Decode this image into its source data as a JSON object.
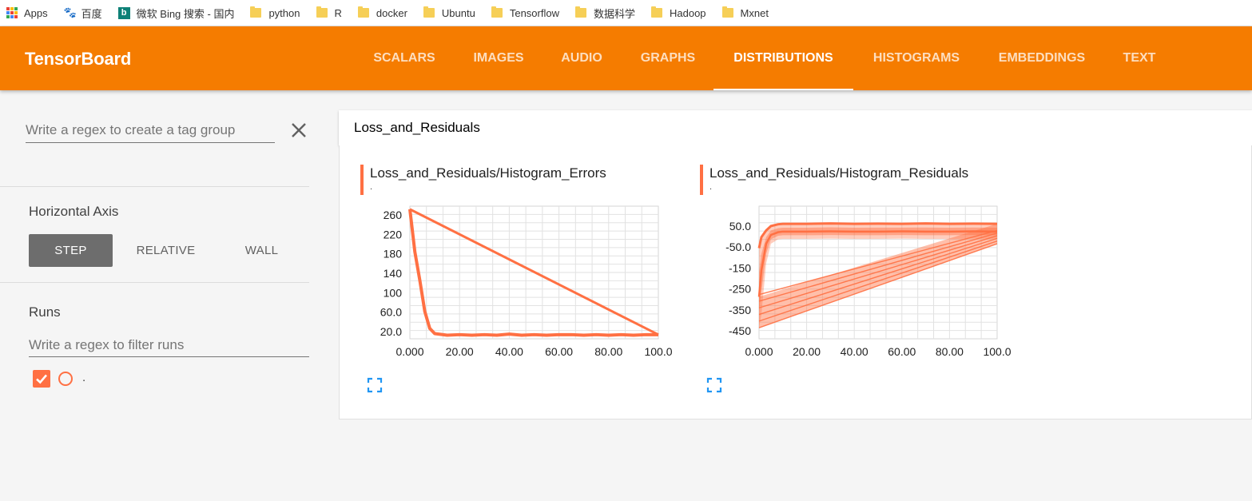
{
  "bookmarks": [
    {
      "label": "Apps",
      "icon": "apps-grid-icon"
    },
    {
      "label": "百度",
      "icon": "baidu-icon"
    },
    {
      "label": "微软 Bing 搜索 - 国内",
      "icon": "bing-icon"
    },
    {
      "label": "python",
      "icon": "folder-icon"
    },
    {
      "label": "R",
      "icon": "folder-icon"
    },
    {
      "label": "docker",
      "icon": "folder-icon"
    },
    {
      "label": "Ubuntu",
      "icon": "folder-icon"
    },
    {
      "label": "Tensorflow",
      "icon": "folder-icon"
    },
    {
      "label": "数据科学",
      "icon": "folder-icon"
    },
    {
      "label": "Hadoop",
      "icon": "folder-icon"
    },
    {
      "label": "Mxnet",
      "icon": "folder-icon"
    }
  ],
  "header": {
    "brand": "TensorBoard",
    "tabs": [
      "SCALARS",
      "IMAGES",
      "AUDIO",
      "GRAPHS",
      "DISTRIBUTIONS",
      "HISTOGRAMS",
      "EMBEDDINGS",
      "TEXT"
    ],
    "active_tab": "DISTRIBUTIONS",
    "color": "#f57c00"
  },
  "sidebar": {
    "tag_regex_placeholder": "Write a regex to create a tag group",
    "horizontal_axis_title": "Horizontal Axis",
    "axis_options": [
      "STEP",
      "RELATIVE",
      "WALL"
    ],
    "axis_selected": "STEP",
    "runs_title": "Runs",
    "runs_regex_placeholder": "Write a regex to filter runs",
    "runs": [
      {
        "label": ".",
        "checked": true,
        "color": "#ff7043"
      }
    ]
  },
  "main": {
    "group_title": "Loss_and_Residuals",
    "series_color": "#ff7043"
  },
  "chart_data": [
    {
      "type": "area",
      "title": "Loss_and_Residuals/Histogram_Errors",
      "subtitle": ".",
      "x_ticks": [
        "0.000",
        "20.00",
        "40.00",
        "60.00",
        "80.00",
        "100.0"
      ],
      "y_ticks": [
        "260",
        "220",
        "180",
        "140",
        "100",
        "60.0",
        "20.0"
      ],
      "xlim": [
        0,
        100
      ],
      "ylim": [
        12,
        268
      ],
      "grid": true,
      "x": [
        0,
        2,
        4,
        6,
        8,
        10,
        15,
        20,
        25,
        30,
        35,
        40,
        45,
        50,
        55,
        60,
        65,
        70,
        75,
        80,
        85,
        90,
        95,
        100
      ],
      "values": [
        262,
        180,
        125,
        65,
        32,
        22,
        19,
        20,
        19,
        20,
        19,
        21,
        19,
        20,
        19,
        20,
        20,
        19,
        20,
        19,
        20,
        19,
        20,
        20
      ],
      "wraparound_line": [
        [
          0,
          262
        ],
        [
          100,
          20
        ]
      ]
    },
    {
      "type": "area",
      "title": "Loss_and_Residuals/Histogram_Residuals",
      "subtitle": ".",
      "x_ticks": [
        "0.000",
        "20.00",
        "40.00",
        "60.00",
        "80.00",
        "100.0"
      ],
      "y_ticks": [
        "50.0",
        "-50.0",
        "-150",
        "-250",
        "-350",
        "-450"
      ],
      "xlim": [
        0,
        100
      ],
      "ylim": [
        -490,
        110
      ],
      "grid": true,
      "x": [
        0,
        1,
        3,
        5,
        8,
        10,
        20,
        30,
        40,
        50,
        60,
        70,
        80,
        90,
        100
      ],
      "upper": [
        -80,
        -30,
        0,
        20,
        28,
        30,
        30,
        32,
        30,
        31,
        30,
        32,
        30,
        31,
        30
      ],
      "median": [
        -300,
        -180,
        -60,
        -20,
        -8,
        -5,
        -5,
        -4,
        -5,
        -5,
        -4,
        -5,
        -5,
        -4,
        -5
      ],
      "lower": [
        -440,
        -380,
        -150,
        -60,
        -40,
        -38,
        -38,
        -37,
        -38,
        -38,
        -37,
        -38,
        -38,
        -37,
        -38
      ],
      "wraparound_lower": [
        [
          0,
          -440
        ],
        [
          100,
          -60
        ]
      ]
    }
  ]
}
